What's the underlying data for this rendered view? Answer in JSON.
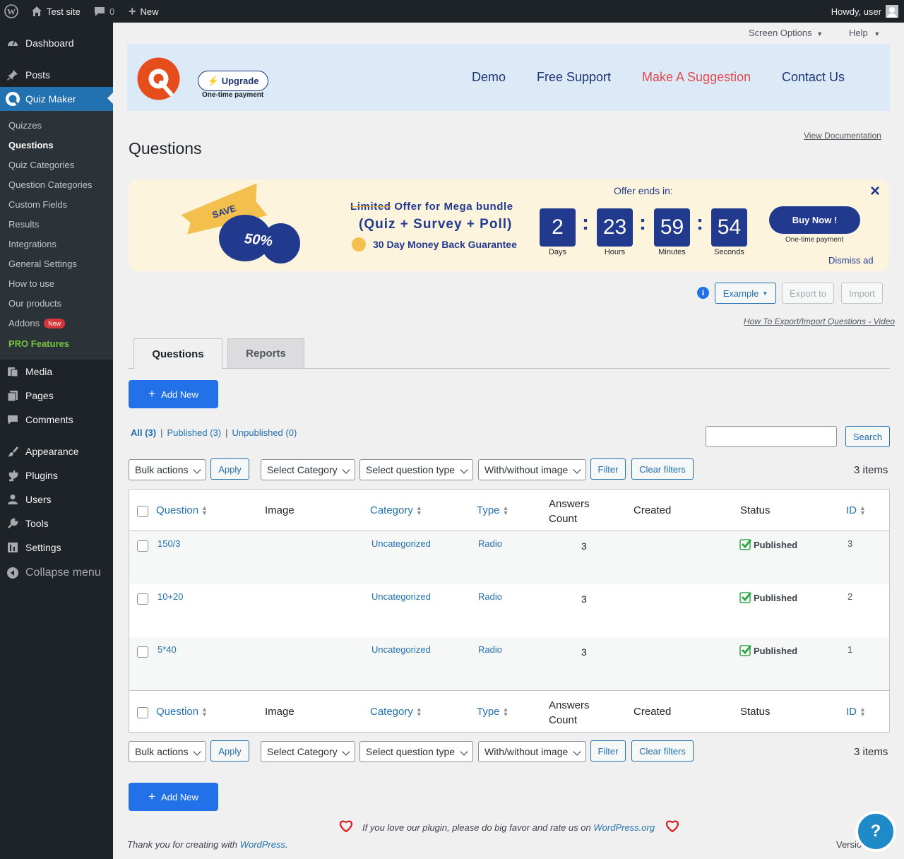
{
  "adminbar": {
    "site_name": "Test site",
    "comments_count": "0",
    "new_label": "New",
    "howdy": "Howdy, user"
  },
  "sidebar": {
    "items": [
      {
        "label": "Dashboard",
        "icon": "dashboard-icon"
      },
      {
        "label": "Posts",
        "icon": "pin-icon"
      },
      {
        "label": "Quiz Maker",
        "icon": "quiz-maker-icon"
      },
      {
        "label": "Media",
        "icon": "media-icon"
      },
      {
        "label": "Pages",
        "icon": "pages-icon"
      },
      {
        "label": "Comments",
        "icon": "comments-icon"
      },
      {
        "label": "Appearance",
        "icon": "brush-icon"
      },
      {
        "label": "Plugins",
        "icon": "plugin-icon"
      },
      {
        "label": "Users",
        "icon": "users-icon"
      },
      {
        "label": "Tools",
        "icon": "wrench-icon"
      },
      {
        "label": "Settings",
        "icon": "settings-icon"
      },
      {
        "label": "Collapse menu",
        "icon": "collapse-icon"
      }
    ],
    "submenu": [
      "Quizzes",
      "Questions",
      "Quiz Categories",
      "Question Categories",
      "Custom Fields",
      "Results",
      "Integrations",
      "General Settings",
      "How to use",
      "Our products",
      "Addons",
      "PRO Features"
    ],
    "addons_badge": "New"
  },
  "top": {
    "screen_options": "Screen Options",
    "help": "Help"
  },
  "plugin_header": {
    "upgrade": "Upgrade",
    "upgrade_sub": "One-time payment",
    "nav": [
      "Demo",
      "Free Support",
      "Make A Suggestion",
      "Contact Us"
    ],
    "suggestion_color": "#e3494c"
  },
  "page": {
    "title": "Questions",
    "view_doc": "View Documentation"
  },
  "promo": {
    "save": "SAVE",
    "percent": "50%",
    "line1_strike": "Limited",
    "line1_rest": " Offer for Mega bundle",
    "line2": "(Quiz + Survey + Poll)",
    "guarantee": "30 Day Money Back Guarantee",
    "offer_ends": "Offer ends in:",
    "countdown": [
      {
        "value": "2",
        "label": "Days"
      },
      {
        "value": "23",
        "label": "Hours"
      },
      {
        "value": "59",
        "label": "Minutes"
      },
      {
        "value": "54",
        "label": "Seconds"
      }
    ],
    "buy_now": "Buy Now !",
    "buy_sub": "One-time payment",
    "dismiss": "Dismiss ad",
    "close": "×"
  },
  "toolbar": {
    "example": "Example",
    "export": "Export to",
    "import": "Import",
    "video_link": "How To Export/Import Questions - Video"
  },
  "tabs": [
    "Questions",
    "Reports"
  ],
  "add_new": "Add New",
  "views": {
    "all": "All (3)",
    "published": "Published (3)",
    "unpublished": "Unpublished (0)",
    "sep": "|"
  },
  "search_button": "Search",
  "filters": {
    "bulk": "Bulk actions",
    "apply": "Apply",
    "category": "Select Category",
    "qtype": "Select question type",
    "image": "With/without image",
    "filter": "Filter",
    "clear": "Clear filters",
    "items": "3 items"
  },
  "table": {
    "columns": {
      "question": "Question",
      "image": "Image",
      "category": "Category",
      "type": "Type",
      "answers1": "Answers",
      "answers2": "Count",
      "created": "Created",
      "status": "Status",
      "id": "ID"
    },
    "rows": [
      {
        "question": "150/3",
        "category": "Uncategorized",
        "type": "Radio",
        "answers": "3",
        "status": "Published",
        "id": "3"
      },
      {
        "question": "10+20",
        "category": "Uncategorized",
        "type": "Radio",
        "answers": "3",
        "status": "Published",
        "id": "2"
      },
      {
        "question": "5*40",
        "category": "Uncategorized",
        "type": "Radio",
        "answers": "3",
        "status": "Published",
        "id": "1"
      }
    ]
  },
  "footer": {
    "rate_prefix": "If you love our plugin, please do big favor and rate us on ",
    "rate_link": "WordPress.org",
    "thanks_prefix": "Thank you for creating with ",
    "thanks_link": "WordPress",
    "thanks_end": ".",
    "version": "Versio",
    "help_button": "?"
  }
}
